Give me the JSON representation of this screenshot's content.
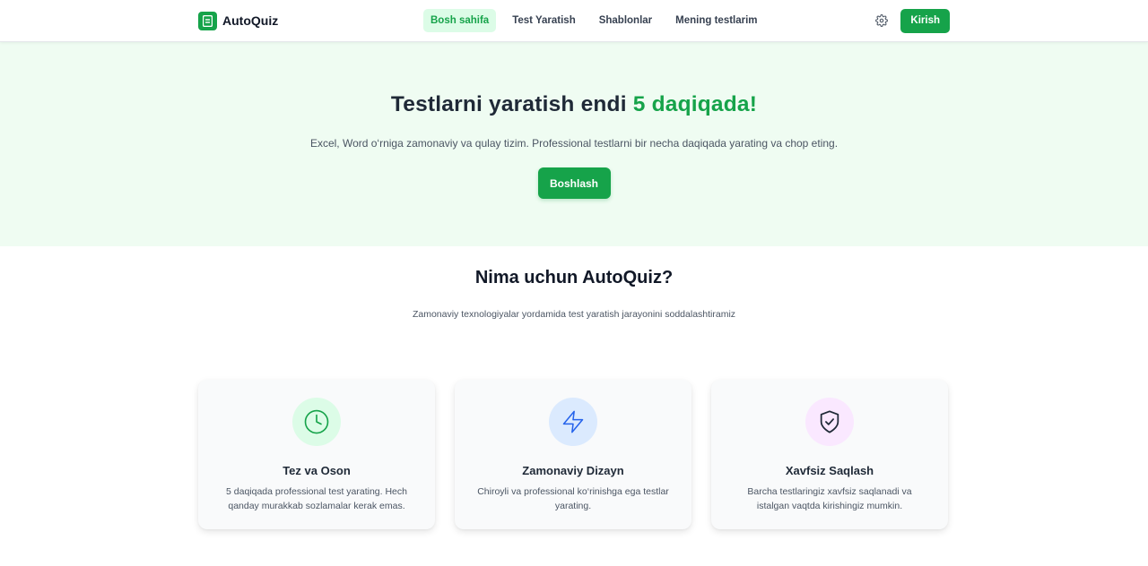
{
  "navbar": {
    "brand": "AutoQuiz",
    "links": [
      {
        "label": "Bosh sahifa",
        "active": true
      },
      {
        "label": "Test Yaratish",
        "active": false
      },
      {
        "label": "Shablonlar",
        "active": false
      },
      {
        "label": "Mening testlarim",
        "active": false
      }
    ],
    "settings_icon": "gear-icon",
    "login_label": "Kirish"
  },
  "hero": {
    "title_main": "Testlarni yaratish endi ",
    "title_accent": "5 daqiqada!",
    "subtitle": "Excel, Word o‘rniga zamonaviy va qulay tizim. Professional testlarni bir necha daqiqada yarating va chop eting.",
    "cta_label": "Boshlash"
  },
  "why": {
    "title": "Nima uchun AutoQuiz?",
    "subtitle": "Zamonaviy texnologiyalar yordamida test yaratish jarayonini soddalashtiramiz"
  },
  "features": [
    {
      "icon": "clock-icon",
      "title": "Tez va Oson",
      "description": "5 daqiqada professional test yarating. Hech qanday murakkab sozlamalar kerak emas."
    },
    {
      "icon": "lightning-icon",
      "title": "Zamonaviy Dizayn",
      "description": "Chiroyli va professional ko‘rinishga ega testlar yarating."
    },
    {
      "icon": "shield-check-icon",
      "title": "Xavfsiz Saqlash",
      "description": "Barcha testlaringiz xavfsiz saqlanadi va istalgan vaqtda kirishingiz mumkin."
    }
  ],
  "colors": {
    "accent": "#16a34a",
    "hero_bg": "#effcf2",
    "active_link_bg": "#dcfce7"
  }
}
